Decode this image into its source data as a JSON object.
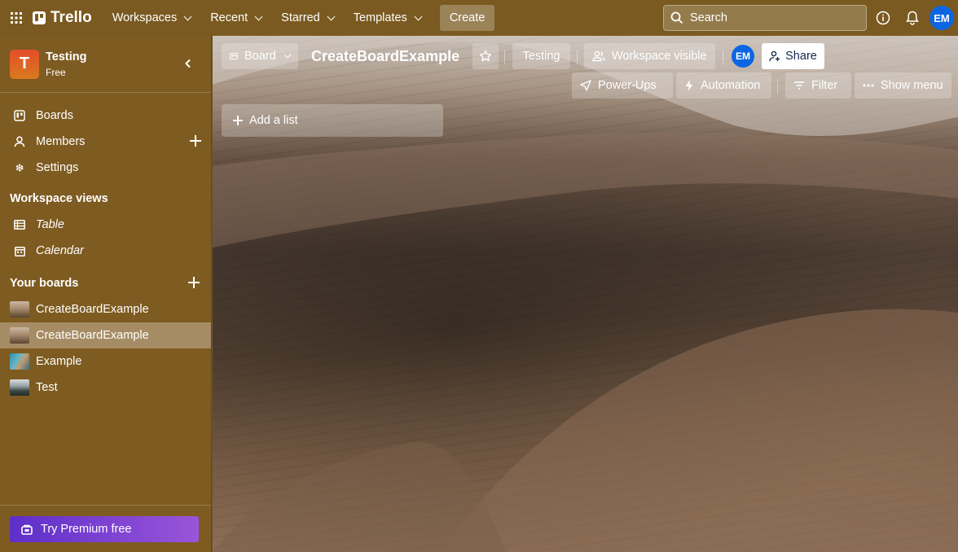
{
  "topnav": {
    "apps_icon": "apps-grid-icon",
    "logo_text": "Trello",
    "menus": [
      "Workspaces",
      "Recent",
      "Starred",
      "Templates"
    ],
    "create_label": "Create",
    "search_placeholder": "Search",
    "avatar_initials": "EM"
  },
  "sidebar": {
    "workspace_initial": "T",
    "workspace_name": "Testing",
    "workspace_plan": "Free",
    "nav": [
      "Boards",
      "Members",
      "Settings"
    ],
    "views_heading": "Workspace views",
    "views": [
      "Table",
      "Calendar"
    ],
    "boards_heading": "Your boards",
    "boards": [
      "CreateBoardExample",
      "CreateBoardExample",
      "Example",
      "Test"
    ],
    "premium_label": "Try Premium free"
  },
  "board": {
    "view_label": "Board",
    "title": "CreateBoardExample",
    "workspace_label": "Testing",
    "visibility_label": "Workspace visible",
    "member_initials": "EM",
    "share_label": "Share",
    "powerups_label": "Power-Ups",
    "automation_label": "Automation",
    "filter_label": "Filter",
    "menu_label": "Show menu",
    "add_list_label": "Add a list"
  },
  "colors": {
    "nav_bg": "#7a5a20",
    "sidebar_bg": "#7e5b21",
    "avatar_bg": "#0c66e4",
    "premium_gradient": [
      "#5e2fc9",
      "#9a55d9"
    ]
  }
}
